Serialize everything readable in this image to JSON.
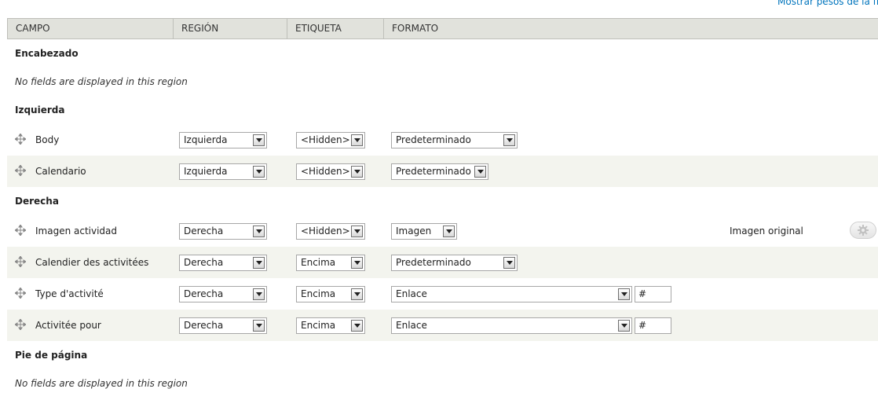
{
  "top_link": "Mostrar pesos de la fila",
  "headers": {
    "campo": "CAMPO",
    "region": "REGIÓN",
    "etiqueta": "ETIQUETA",
    "formato": "FORMATO"
  },
  "regions": {
    "encabezado": {
      "title": "Encabezado",
      "empty": "No fields are displayed in this region"
    },
    "izquierda": {
      "title": "Izquierda"
    },
    "derecha": {
      "title": "Derecha"
    },
    "pie": {
      "title": "Pie de página",
      "empty": "No fields are displayed in this region"
    }
  },
  "fields": [
    {
      "name": "Body",
      "region": "Izquierda",
      "label": "<Hidden>",
      "format": "Predeterminado"
    },
    {
      "name": "Calendario",
      "region": "Izquierda",
      "label": "<Hidden>",
      "format": "Predeterminado"
    },
    {
      "name": "Imagen actividad",
      "region": "Derecha",
      "label": "<Hidden>",
      "format": "Imagen",
      "summary": "Imagen original"
    },
    {
      "name": "Calendier des activitées",
      "region": "Derecha",
      "label": "Encima",
      "format": "Predeterminado"
    },
    {
      "name": "Type d'activité",
      "region": "Derecha",
      "label": "Encima",
      "format": "Enlace",
      "extra": "#"
    },
    {
      "name": "Activitée pour",
      "region": "Derecha",
      "label": "Encima",
      "format": "Enlace",
      "extra": "#"
    }
  ],
  "icons": {
    "drag": "drag-handle-icon",
    "gear": "gear-icon",
    "dropdown": "chevron-down-icon"
  }
}
